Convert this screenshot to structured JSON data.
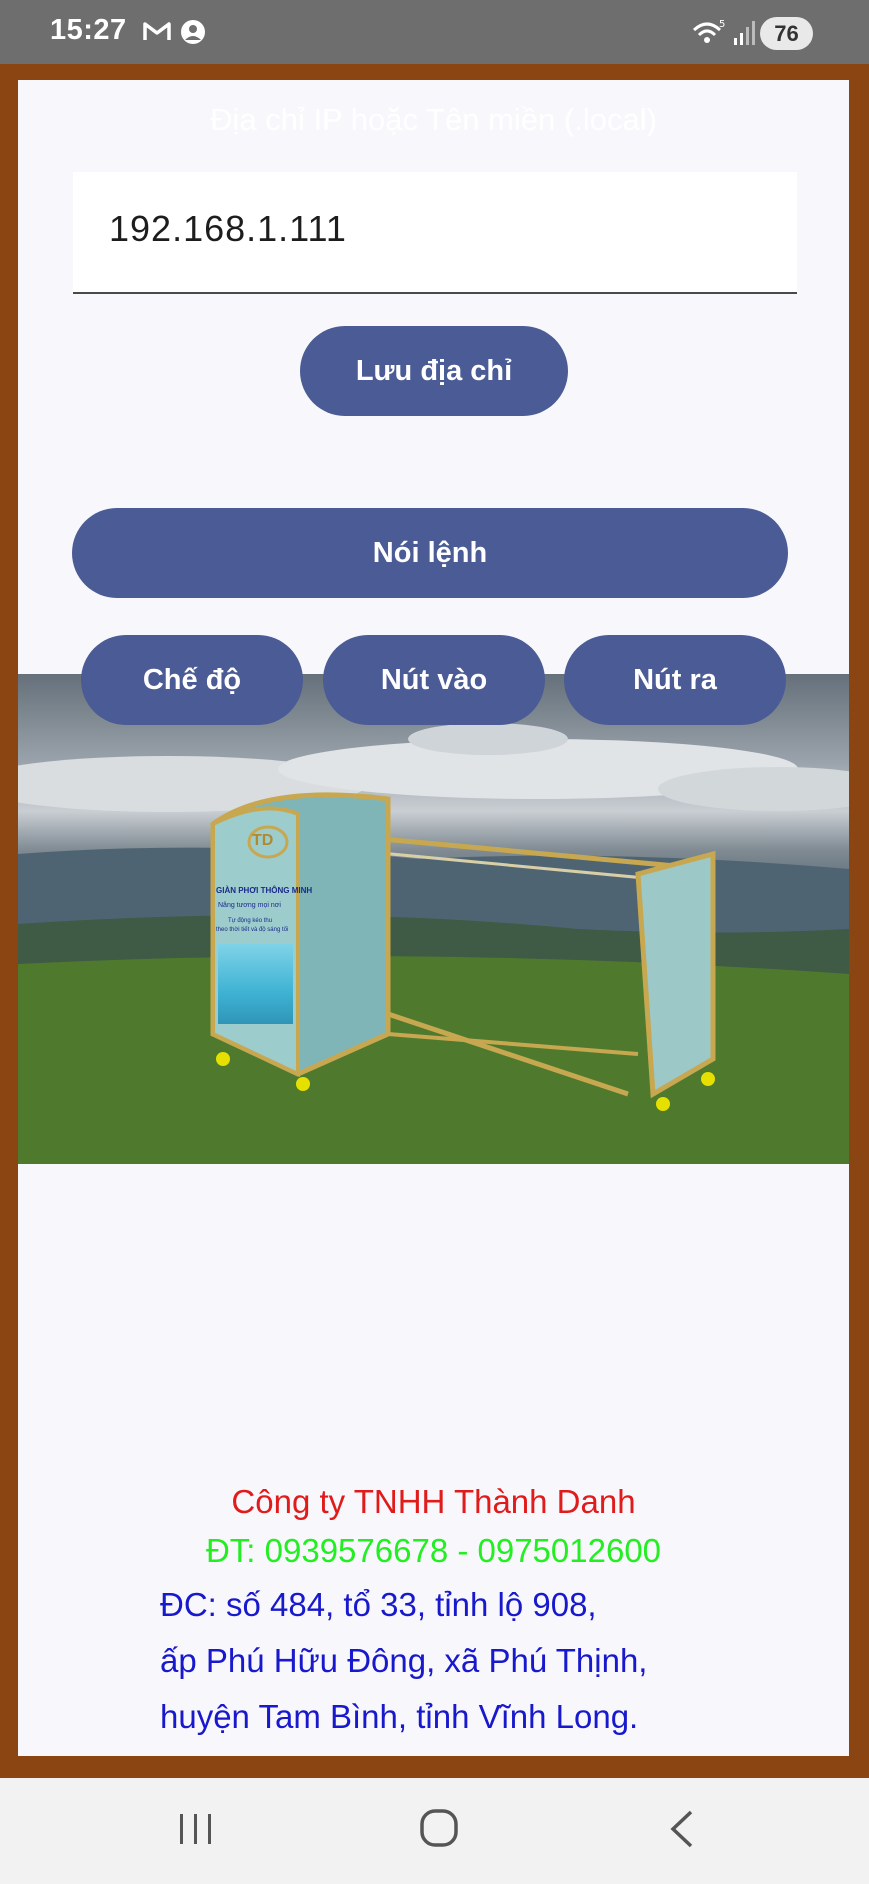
{
  "status_bar": {
    "time": "15:27",
    "battery_level": "76",
    "icons": [
      "gmail-icon",
      "notification-icon",
      "wifi-icon",
      "signal-icon",
      "battery-icon"
    ]
  },
  "form": {
    "field_label": "Địa chỉ IP hoặc Tên miền (.local)",
    "ip_value": "192.168.1.111",
    "save_button": "Lưu địa chỉ"
  },
  "controls": {
    "speak_button": "Nói lệnh",
    "mode_button": "Chế độ",
    "in_button": "Nút vào",
    "out_button": "Nút ra"
  },
  "hero": {
    "product_logo": "TD",
    "panel_title": "GIÀN PHƠI THÔNG MINH",
    "panel_line1": "Nâng tương mọi nơi",
    "panel_line2": "Tự động kéo thu",
    "panel_line3": "theo thời tiết và độ sáng tối"
  },
  "footer": {
    "company": "Công ty TNHH Thành Danh",
    "phone": "ĐT: 0939576678 - 0975012600",
    "address_line1": "ĐC: số 484, tổ 33, tỉnh lộ 908,",
    "address_line2": "ấp Phú Hữu Đông, xã Phú Thịnh,",
    "address_line3": "huyện Tam Bình, tỉnh Vĩnh Long."
  },
  "colors": {
    "frame": "#8b4513",
    "button": "#4a5b95",
    "company_text": "#e01b1b",
    "phone_text": "#22ee22",
    "address_text": "#1818cc"
  }
}
